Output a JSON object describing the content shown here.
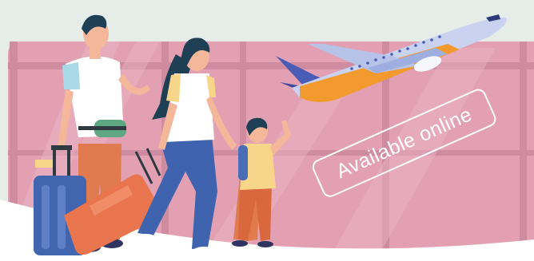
{
  "badge": {
    "text": "Available online"
  },
  "colors": {
    "background": "#e6ece8",
    "window_pink": "#e2a0b2",
    "airplane_body": "#c9d3ef",
    "airplane_wing": "#f39a2e",
    "airplane_tail": "#4a5cb5",
    "stamp_border": "#ffffff"
  },
  "illustration": {
    "subjects": [
      "family-with-luggage",
      "airplane-taking-off",
      "airport-window"
    ]
  }
}
